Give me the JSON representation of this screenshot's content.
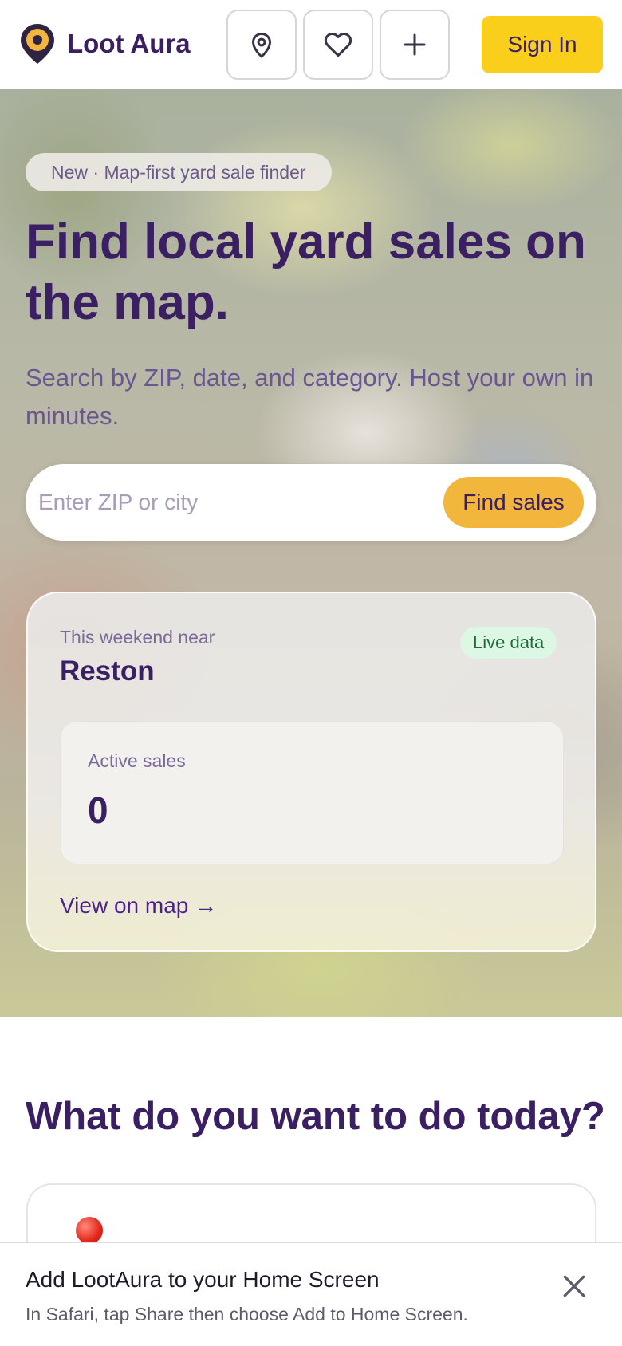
{
  "header": {
    "brand": "Loot Aura",
    "sign_in_label": "Sign In",
    "icons": [
      "map-pin-icon",
      "heart-icon",
      "plus-icon"
    ],
    "colors": {
      "brand_purple": "#3b1f63",
      "accent_yellow": "#f9cf1c",
      "pin_gold": "#f3b63c"
    }
  },
  "hero": {
    "badge": "New · Map-first yard sale finder",
    "title": "Find local yard sales on the map.",
    "subtitle": "Search by ZIP, date, and category. Host your own in minutes.",
    "search": {
      "placeholder": "Enter ZIP or city",
      "value": "",
      "button_label": "Find sales"
    },
    "card": {
      "near_label": "This weekend near",
      "city": "Reston",
      "live_badge": "Live data",
      "stat_label": "Active sales",
      "stat_value": "0",
      "link": "View on map →"
    }
  },
  "section": {
    "title": "What do you want to do today?",
    "first_card_icon": "red-pin-emoji"
  },
  "install_banner": {
    "title": "Add LootAura to your Home Screen",
    "subtitle": "In Safari, tap Share then choose Add to Home Screen."
  }
}
